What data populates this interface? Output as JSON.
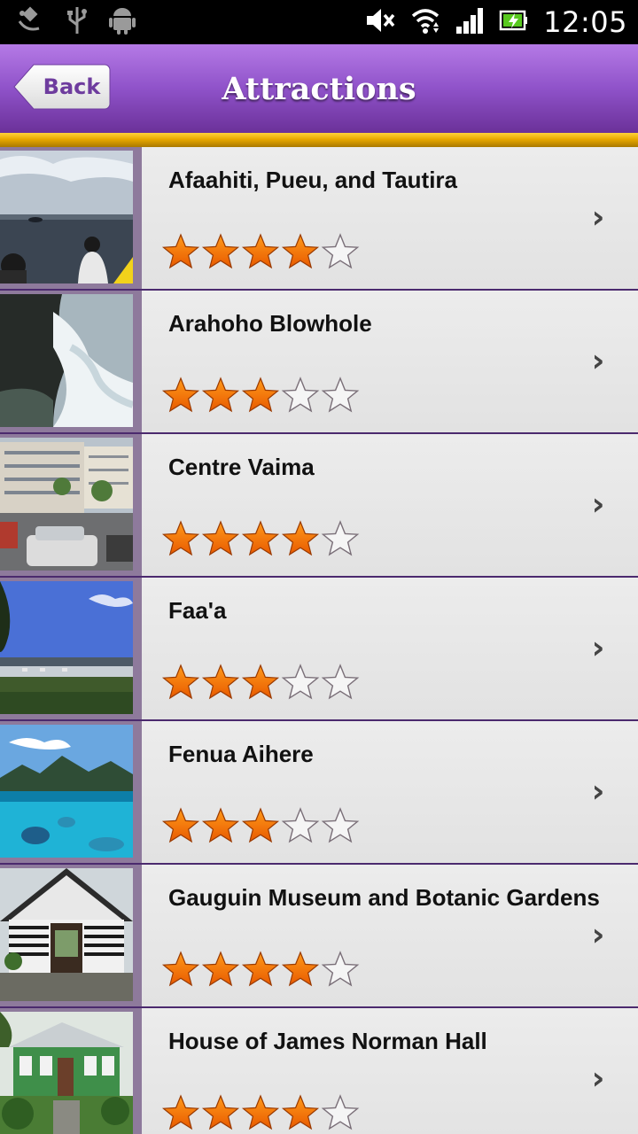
{
  "status_bar": {
    "time": "12:05",
    "left_icons": [
      "satellite-icon",
      "usb-icon",
      "android-icon"
    ],
    "right_icons": [
      "mute-icon",
      "wifi-icon",
      "signal-icon",
      "battery-charging-icon"
    ]
  },
  "header": {
    "title": "Attractions",
    "back_label": "Back",
    "accent_color": "#8f52c9",
    "rule_color": "#f2b800"
  },
  "attractions": [
    {
      "name": "Afaahiti, Pueu, and Tautira",
      "rating": 4,
      "max_rating": 5,
      "thumb": "ocean-boat-photo"
    },
    {
      "name": "Arahoho Blowhole",
      "rating": 3,
      "max_rating": 5,
      "thumb": "blowhole-wave-photo"
    },
    {
      "name": "Centre Vaima",
      "rating": 4,
      "max_rating": 5,
      "thumb": "city-street-photo"
    },
    {
      "name": "Faa'a",
      "rating": 3,
      "max_rating": 5,
      "thumb": "airport-field-photo"
    },
    {
      "name": "Fenua Aihere",
      "rating": 3,
      "max_rating": 5,
      "thumb": "lagoon-mountains-photo"
    },
    {
      "name": "Gauguin Museum and Botanic Gardens",
      "rating": 4,
      "max_rating": 5,
      "thumb": "museum-building-photo"
    },
    {
      "name": "House of James Norman Hall",
      "rating": 4,
      "max_rating": 5,
      "thumb": "green-house-photo"
    }
  ]
}
